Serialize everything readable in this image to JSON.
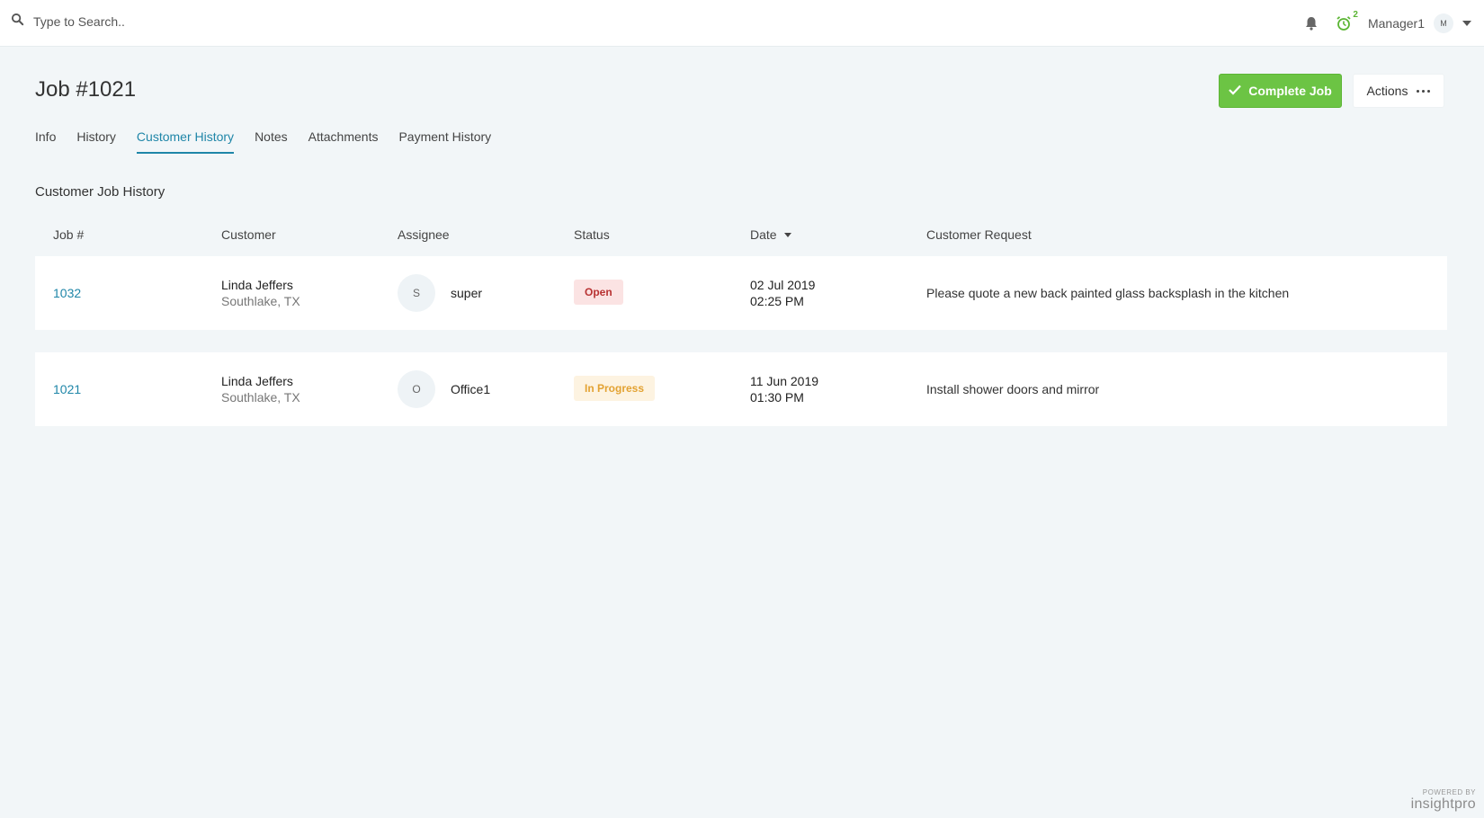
{
  "search": {
    "placeholder": "Type to Search.."
  },
  "header": {
    "alarm_count": "2",
    "user_name": "Manager1",
    "user_initial": "M"
  },
  "job": {
    "title": "Job #1021",
    "complete_label": "Complete Job",
    "actions_label": "Actions"
  },
  "tabs": [
    {
      "label": "Info"
    },
    {
      "label": "History"
    },
    {
      "label": "Customer History"
    },
    {
      "label": "Notes"
    },
    {
      "label": "Attachments"
    },
    {
      "label": "Payment History"
    }
  ],
  "active_tab": "Customer History",
  "section_title": "Customer Job History",
  "table": {
    "columns": [
      "Job #",
      "Customer",
      "Assignee",
      "Status",
      "Date",
      "Customer Request"
    ],
    "sorted_by": "Date",
    "rows": [
      {
        "job": "1032",
        "customer": "Linda Jeffers",
        "location": "Southlake, TX",
        "assignee_initial": "S",
        "assignee": "super",
        "status": "Open",
        "date": "02 Jul 2019",
        "time": "02:25 PM",
        "request": "Please quote a new back painted glass backsplash in the kitchen"
      },
      {
        "job": "1021",
        "customer": "Linda Jeffers",
        "location": "Southlake, TX",
        "assignee_initial": "O",
        "assignee": "Office1",
        "status": "In Progress",
        "date": "11 Jun 2019",
        "time": "01:30 PM",
        "request": "Install shower doors and mirror"
      }
    ]
  },
  "footer": {
    "powered_by": "POWERED BY",
    "brand": "insightpro"
  },
  "colors": {
    "accent": "#1f86a8",
    "complete_button": "#6cc444",
    "open_badge": "#b83232",
    "in_progress_badge": "#e3a232",
    "alarm": "#5bb534"
  },
  "icons": [
    "search-icon",
    "bell-icon",
    "alarm-clock-icon",
    "chevron-down-icon",
    "check-icon",
    "more-dots-icon",
    "sort-down-icon"
  ]
}
